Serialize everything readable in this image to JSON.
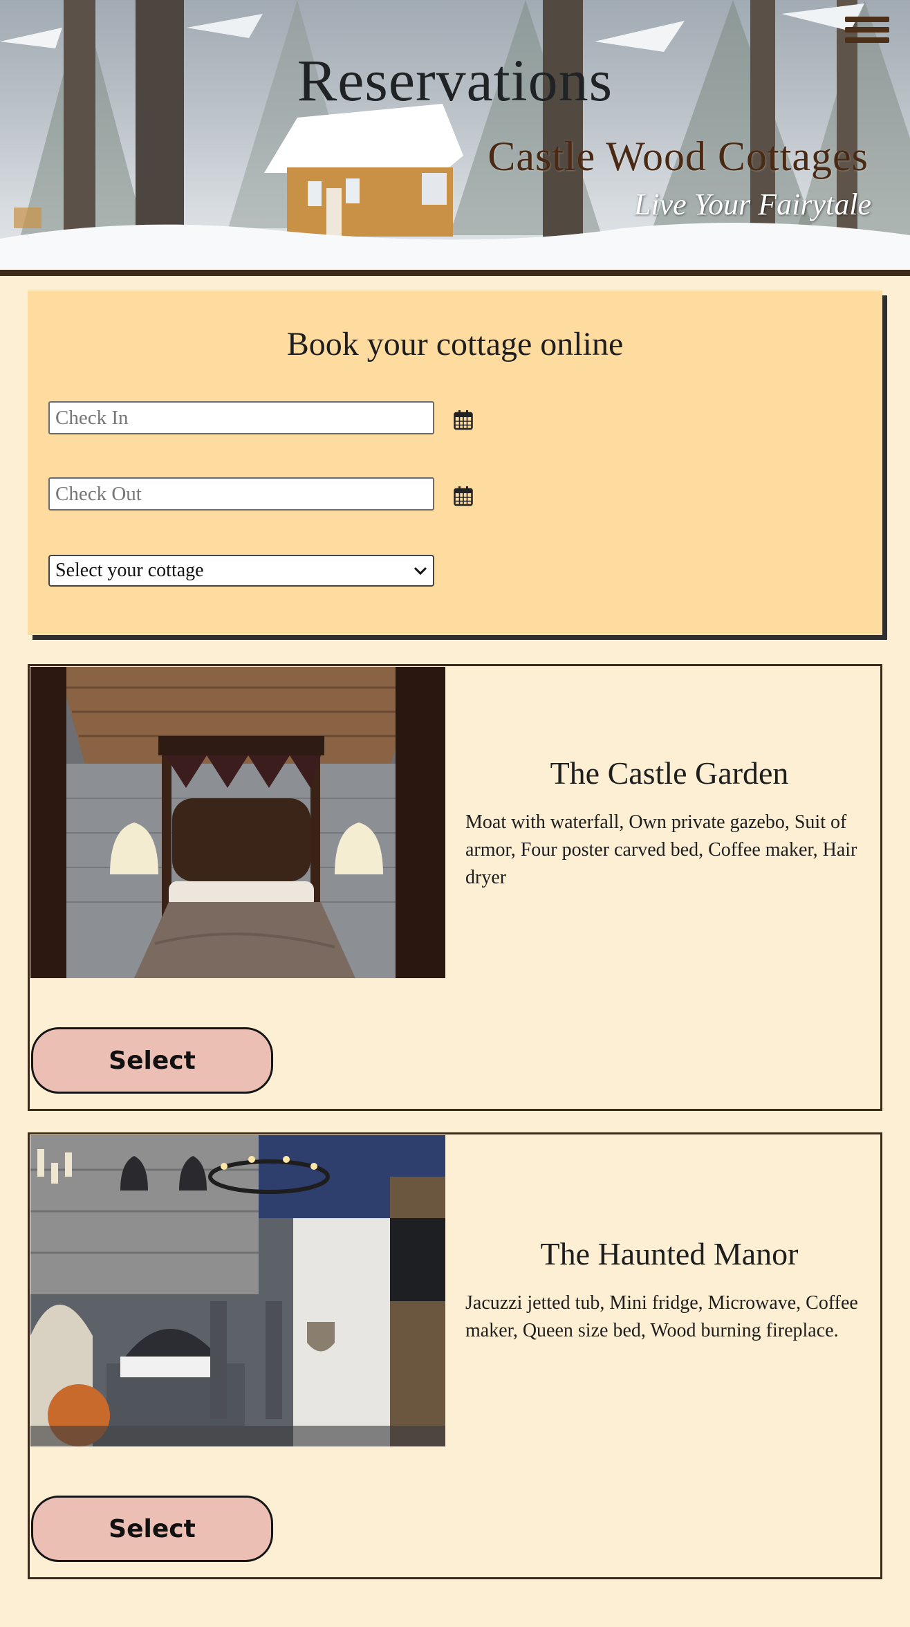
{
  "header": {
    "title": "Reservations",
    "brand": "Castle Wood Cottages",
    "tagline": "Live Your Fairytale",
    "menu_icon": "hamburger-menu-icon",
    "accent_color": "#3e2a17"
  },
  "booking": {
    "title": "Book your cottage online",
    "check_in": {
      "placeholder": "Check In",
      "value": ""
    },
    "check_out": {
      "placeholder": "Check Out",
      "value": ""
    },
    "calendar_icon": "calendar-icon",
    "cottage_select": {
      "selected": "Select your cottage"
    },
    "background_color": "#fedb9f"
  },
  "cottages": [
    {
      "name": "The Castle Garden",
      "description": "Moat with waterfall, Own private gazebo, Suit of armor, Four poster carved bed, Coffee maker, Hair dryer",
      "button_label": "Select"
    },
    {
      "name": "The Haunted Manor",
      "description": "Jacuzzi jetted tub, Mini fridge, Microwave, Coffee maker, Queen size bed, Wood burning fireplace.",
      "button_label": "Select"
    }
  ],
  "colors": {
    "page_background": "#fdefd3",
    "select_button": "#ecbfb5",
    "card_border": "#3b2a1a"
  }
}
